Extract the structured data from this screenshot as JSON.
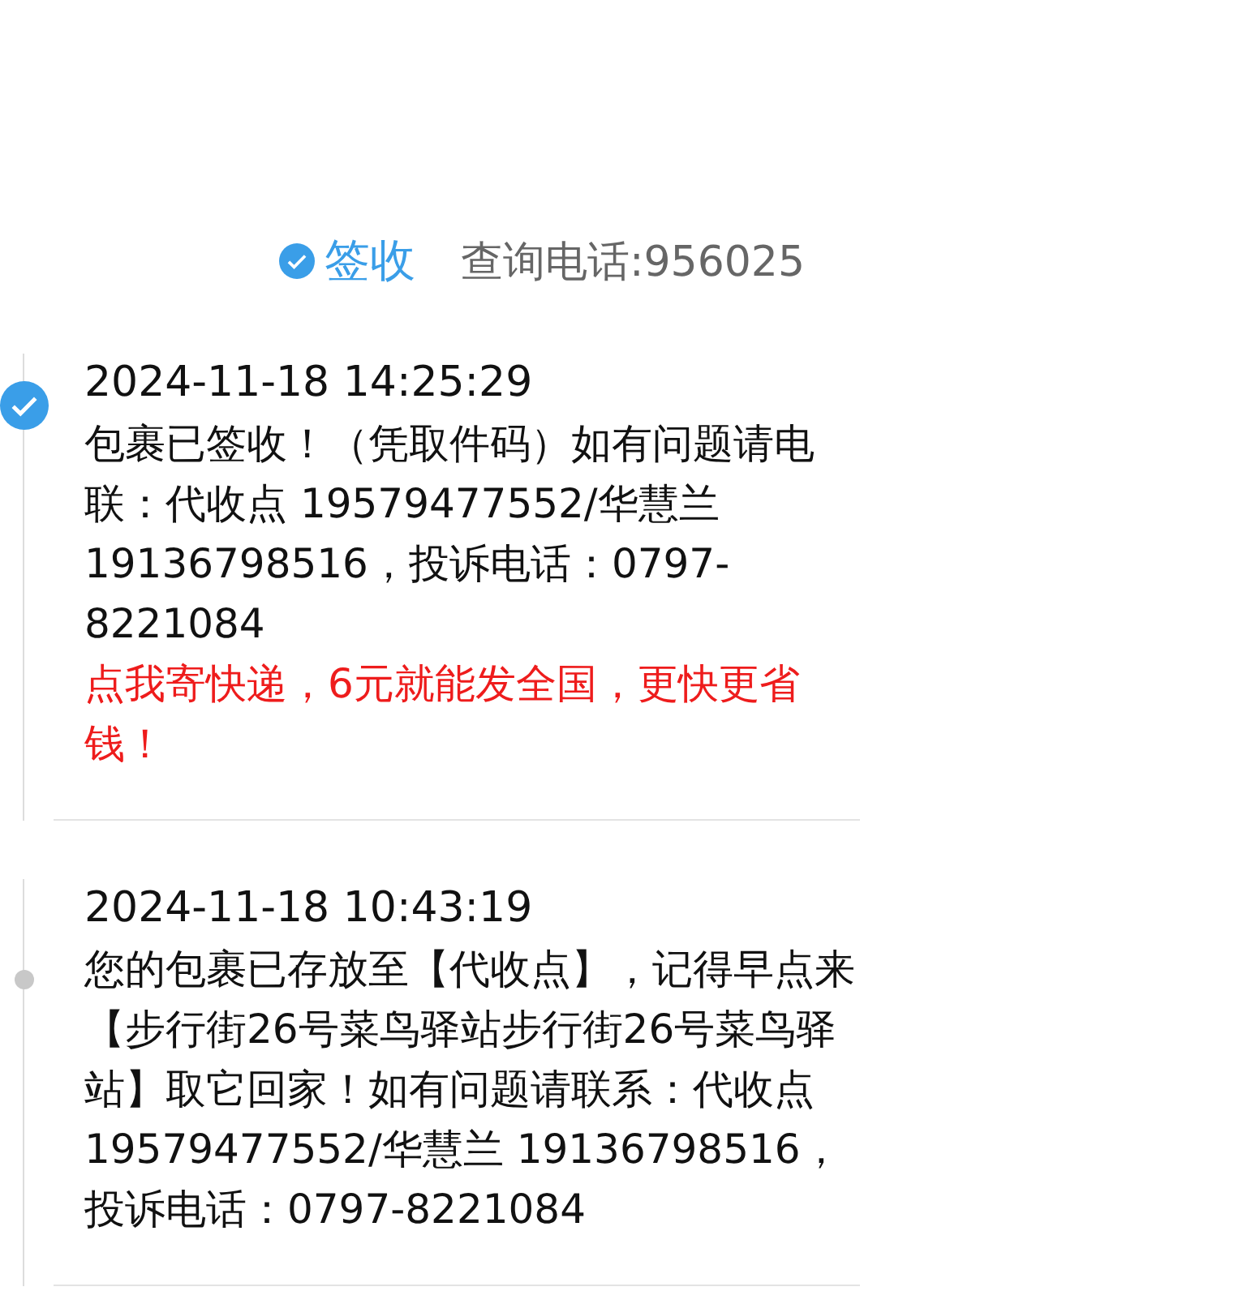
{
  "header": {
    "status": "签收",
    "phone": "查询电话:956025"
  },
  "events": [
    {
      "kind": "check",
      "time": "2024-11-18 14:25:29",
      "text": "包裹已签收！（凭取件码）如有问题请电联：代收点 19579477552/华慧兰 19136798516，投诉电话：0797-8221084",
      "promo": "点我寄快递，6元就能发全国，更快更省钱！"
    },
    {
      "kind": "dot",
      "time": "2024-11-18 10:43:19",
      "text": "您的包裹已存放至【代收点】，记得早点来【步行街26号菜鸟驿站步行街26号菜鸟驿站】取它回家！如有问题请联系：代收点 19579477552/华慧兰 19136798516，投诉电话：0797-8221084"
    }
  ]
}
